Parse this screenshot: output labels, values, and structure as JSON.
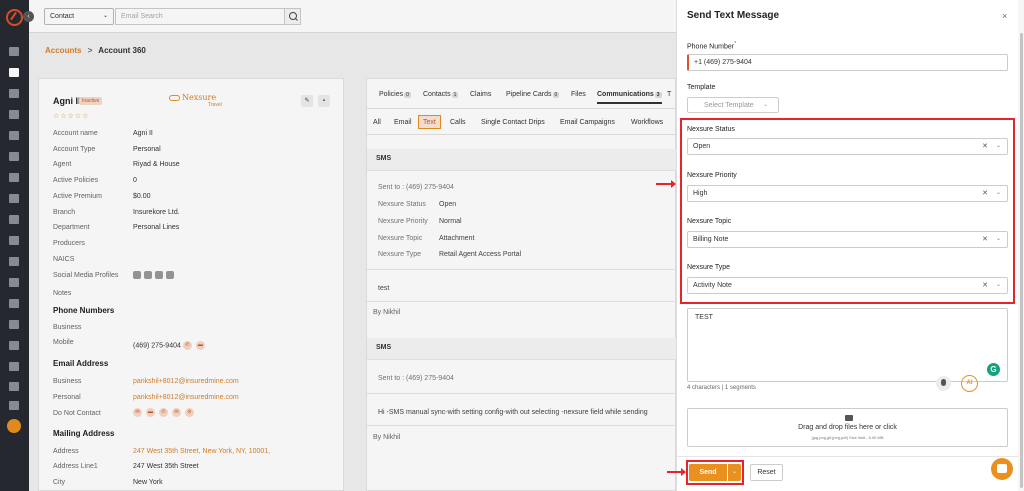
{
  "search": {
    "entity": "Contact",
    "placeholder": "Email Search"
  },
  "breadcrumb": {
    "parent": "Accounts",
    "sep": ">",
    "current": "Account 360"
  },
  "account": {
    "name": "Agni II",
    "badge": "Inactive",
    "stars": "☆☆☆☆☆",
    "brand": "Nexsure",
    "brand_sub": "Travel",
    "fields": [
      {
        "label": "Account name",
        "value": "Agni II"
      },
      {
        "label": "Account Type",
        "value": "Personal"
      },
      {
        "label": "Agent",
        "value": "Riyad & House"
      },
      {
        "label": "Active Policies",
        "value": "0"
      },
      {
        "label": "Active Premium",
        "value": "$0.00"
      },
      {
        "label": "Branch",
        "value": "Insurekore Ltd."
      },
      {
        "label": "Department",
        "value": "Personal Lines"
      },
      {
        "label": "Producers",
        "value": ""
      },
      {
        "label": "NAICS",
        "value": ""
      },
      {
        "label": "Social Media Profiles",
        "value": ""
      },
      {
        "label": "Notes",
        "value": ""
      }
    ],
    "phone_section": "Phone Numbers",
    "business_label": "Business",
    "mobile_label": "Mobile",
    "mobile_value": "(469) 275-9404",
    "email_section": "Email Address",
    "email_business_label": "Business",
    "email_business_value": "pankshil+8012@insuredmine.com",
    "email_personal_label": "Personal",
    "email_personal_value": "pankshil+8012@insuredmine.com",
    "dnc_label": "Do Not Contact",
    "mailing_section": "Mailing Address",
    "address_label": "Address",
    "address_value": "247 West 35th Street, New York, NY, 10001,",
    "address1_label": "Address Line1",
    "address1_value": "247 West 35th Street",
    "city_label": "City",
    "city_value": "New York"
  },
  "main_tabs": [
    {
      "label": "Policies",
      "count": "0"
    },
    {
      "label": "Contacts",
      "count": "1"
    },
    {
      "label": "Claims",
      "count": ""
    },
    {
      "label": "Pipeline Cards",
      "count": "0"
    },
    {
      "label": "Files",
      "count": ""
    },
    {
      "label": "Communications",
      "count": "3"
    },
    {
      "label": "T",
      "count": ""
    }
  ],
  "sub_tabs": [
    "All",
    "Email",
    "Text",
    "Calls",
    "Single Contact Drips",
    "Email Campaigns",
    "Workflows"
  ],
  "sms1": {
    "header": "SMS",
    "sent_to": "Sent to : (469) 275-9404",
    "rows": [
      {
        "label": "Nexsure Status",
        "value": "Open"
      },
      {
        "label": "Nexsure Priority",
        "value": "Normal"
      },
      {
        "label": "Nexsure Topic",
        "value": "Attachment"
      },
      {
        "label": "Nexsure Type",
        "value": "Retail Agent Access Portal"
      }
    ],
    "body": "test",
    "by": "By Nikhil"
  },
  "sms2": {
    "header": "SMS",
    "sent_to": "Sent to : (469) 275-9404",
    "body": "Hi -SMS manual sync-with setting config-with out selecting -nexsure field while sending",
    "by": "By Nikhil"
  },
  "panel": {
    "title": "Send Text Message",
    "close": "×",
    "phone_label": "Phone Number",
    "required": "*",
    "phone_value": "+1 (469) 275-9404",
    "template_label": "Template",
    "template_placeholder": "Select Template",
    "nexsure": [
      {
        "label": "Nexsure Status",
        "value": "Open"
      },
      {
        "label": "Nexsure Priority",
        "value": "High"
      },
      {
        "label": "Nexsure Topic",
        "value": "Billing Note"
      },
      {
        "label": "Nexsure Type",
        "value": "Activity Note"
      }
    ],
    "message": "TEST",
    "counter": "4 characters | 1 segments",
    "ai_label": "AI",
    "grammarly": "G",
    "drop_text": "Drag and drop files here or click",
    "drop_hint": "(jpg,png,gif,jpeg,pdf) Size limit - 5.00 MB",
    "send_label": "Send",
    "reset_label": "Reset"
  },
  "colors": {
    "accent": "#e9901f",
    "highlight": "#e4262c",
    "sidebar": "#272a30"
  }
}
